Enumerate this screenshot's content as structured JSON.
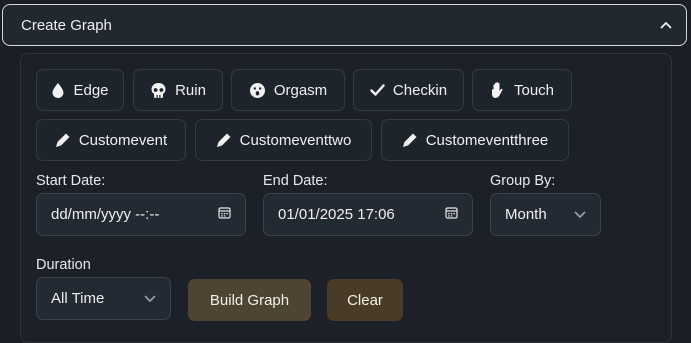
{
  "header": {
    "title": "Create Graph",
    "toggle_icon": "chevron-up-icon"
  },
  "event_types": [
    {
      "label": "Edge",
      "icon": "droplet-icon"
    },
    {
      "label": "Ruin",
      "icon": "skull-icon"
    },
    {
      "label": "Orgasm",
      "icon": "surprised-face-icon"
    },
    {
      "label": "Checkin",
      "icon": "checkmark-icon"
    },
    {
      "label": "Touch",
      "icon": "hand-icon"
    },
    {
      "label": "Customevent",
      "icon": "pen-icon"
    },
    {
      "label": "Customeventtwo",
      "icon": "pen-icon"
    },
    {
      "label": "Customeventthree",
      "icon": "pen-icon"
    }
  ],
  "filters": {
    "start_date": {
      "label": "Start Date:",
      "value": "dd/mm/yyyy --:--"
    },
    "end_date": {
      "label": "End Date:",
      "value": "01/01/2025 17:06"
    },
    "group_by": {
      "label": "Group By:",
      "value": "Month"
    },
    "duration": {
      "label": "Duration",
      "value": "All Time"
    }
  },
  "actions": {
    "build": "Build Graph",
    "clear": "Clear"
  },
  "colors": {
    "background": "#1a1f26",
    "panel": "#1c2129",
    "build_button": "#4d4432",
    "clear_button": "#4a3b26"
  }
}
